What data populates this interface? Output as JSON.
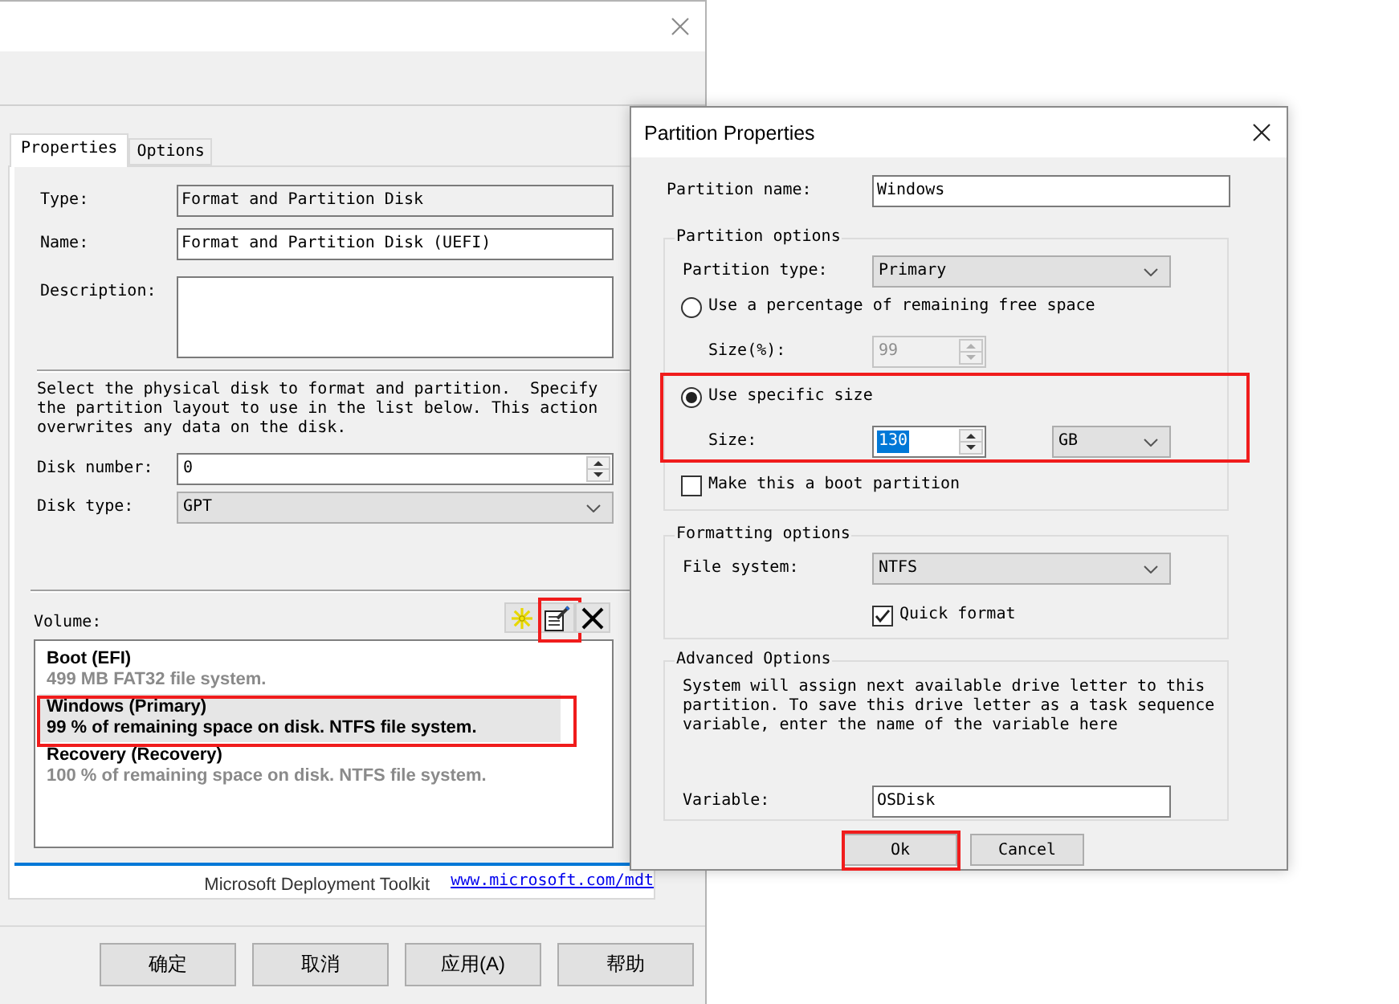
{
  "main_window": {
    "tabs": [
      {
        "label": "Properties",
        "selected": true
      },
      {
        "label": "Options",
        "selected": false
      }
    ],
    "task_fields": [
      {
        "kind": "readonly",
        "label": "Type:",
        "value": "Format and Partition Disk"
      },
      {
        "kind": "text",
        "label": "Name:",
        "value": "Format and Partition Disk (UEFI)"
      },
      {
        "kind": "multiline",
        "label": "Description:"
      }
    ],
    "instructions": "Select the physical disk to format and partition.  Specify the partition layout to use in the list below. This action overwrites any data on the disk.",
    "disk_fields": [
      {
        "kind": "spin",
        "label": "Disk number:",
        "value": "0"
      },
      {
        "kind": "dropdown",
        "label": "Disk type:",
        "value": "GPT"
      }
    ],
    "volume": {
      "label": "Volume:",
      "tools": [
        {
          "kind": "new",
          "highlighted": false
        },
        {
          "kind": "edit",
          "highlighted": true
        },
        {
          "kind": "delete",
          "highlighted": false
        }
      ],
      "items": [
        {
          "title": "Boot (EFI)",
          "detail": "499 MB FAT32 file system.",
          "selected": false,
          "highlighted": false
        },
        {
          "title": "Windows (Primary)",
          "detail": "99 % of remaining space on disk. NTFS file system.",
          "selected": true,
          "highlighted": true
        },
        {
          "title": "Recovery (Recovery)",
          "detail": "100 % of remaining space on disk. NTFS file system.",
          "selected": false,
          "highlighted": false
        }
      ]
    },
    "footer": {
      "brand": "Microsoft Deployment Toolkit",
      "link": "www.microsoft.com/mdt"
    },
    "buttons": [
      {
        "label": "确定"
      },
      {
        "label": "取消"
      },
      {
        "label": "应用(A)"
      },
      {
        "label": "帮助"
      }
    ]
  },
  "partition_dialog": {
    "title": "Partition Properties",
    "name_field": {
      "kind": "text",
      "label": "Partition name:",
      "value": "Windows"
    },
    "groups": [
      {
        "title": "Partition options",
        "rows": [
          {
            "kind": "dropdown",
            "label": "Partition type:",
            "value": "Primary"
          },
          {
            "kind": "size_mode",
            "label": "Use a percentage of remaining free space",
            "selected": false,
            "highlighted": false,
            "size": {
              "label": "Size(%):",
              "value": "99",
              "disabled": true,
              "value_selected": false
            }
          },
          {
            "kind": "size_mode",
            "label": "Use specific size",
            "selected": true,
            "highlighted": true,
            "size": {
              "label": "Size:",
              "value": "130",
              "disabled": false,
              "value_selected": true,
              "unit": "GB"
            }
          },
          {
            "kind": "checkbox",
            "label": "Make this a boot partition",
            "checked": false
          }
        ]
      },
      {
        "title": "Formatting options",
        "rows": [
          {
            "kind": "dropdown",
            "label": "File system:",
            "value": "NTFS"
          },
          {
            "kind": "field_checkbox",
            "label": "Quick format",
            "checked": true
          }
        ]
      },
      {
        "title": "Advanced Options",
        "rows": [
          {
            "kind": "note",
            "text": "System will assign next available drive letter to this partition. To save this drive letter as a task sequence variable, enter the name of the variable here"
          },
          {
            "kind": "text",
            "label": "Variable:",
            "value": "OSDisk"
          }
        ]
      }
    ],
    "buttons": [
      {
        "label": "Ok",
        "highlighted": true
      },
      {
        "label": "Cancel",
        "highlighted": false
      }
    ]
  }
}
